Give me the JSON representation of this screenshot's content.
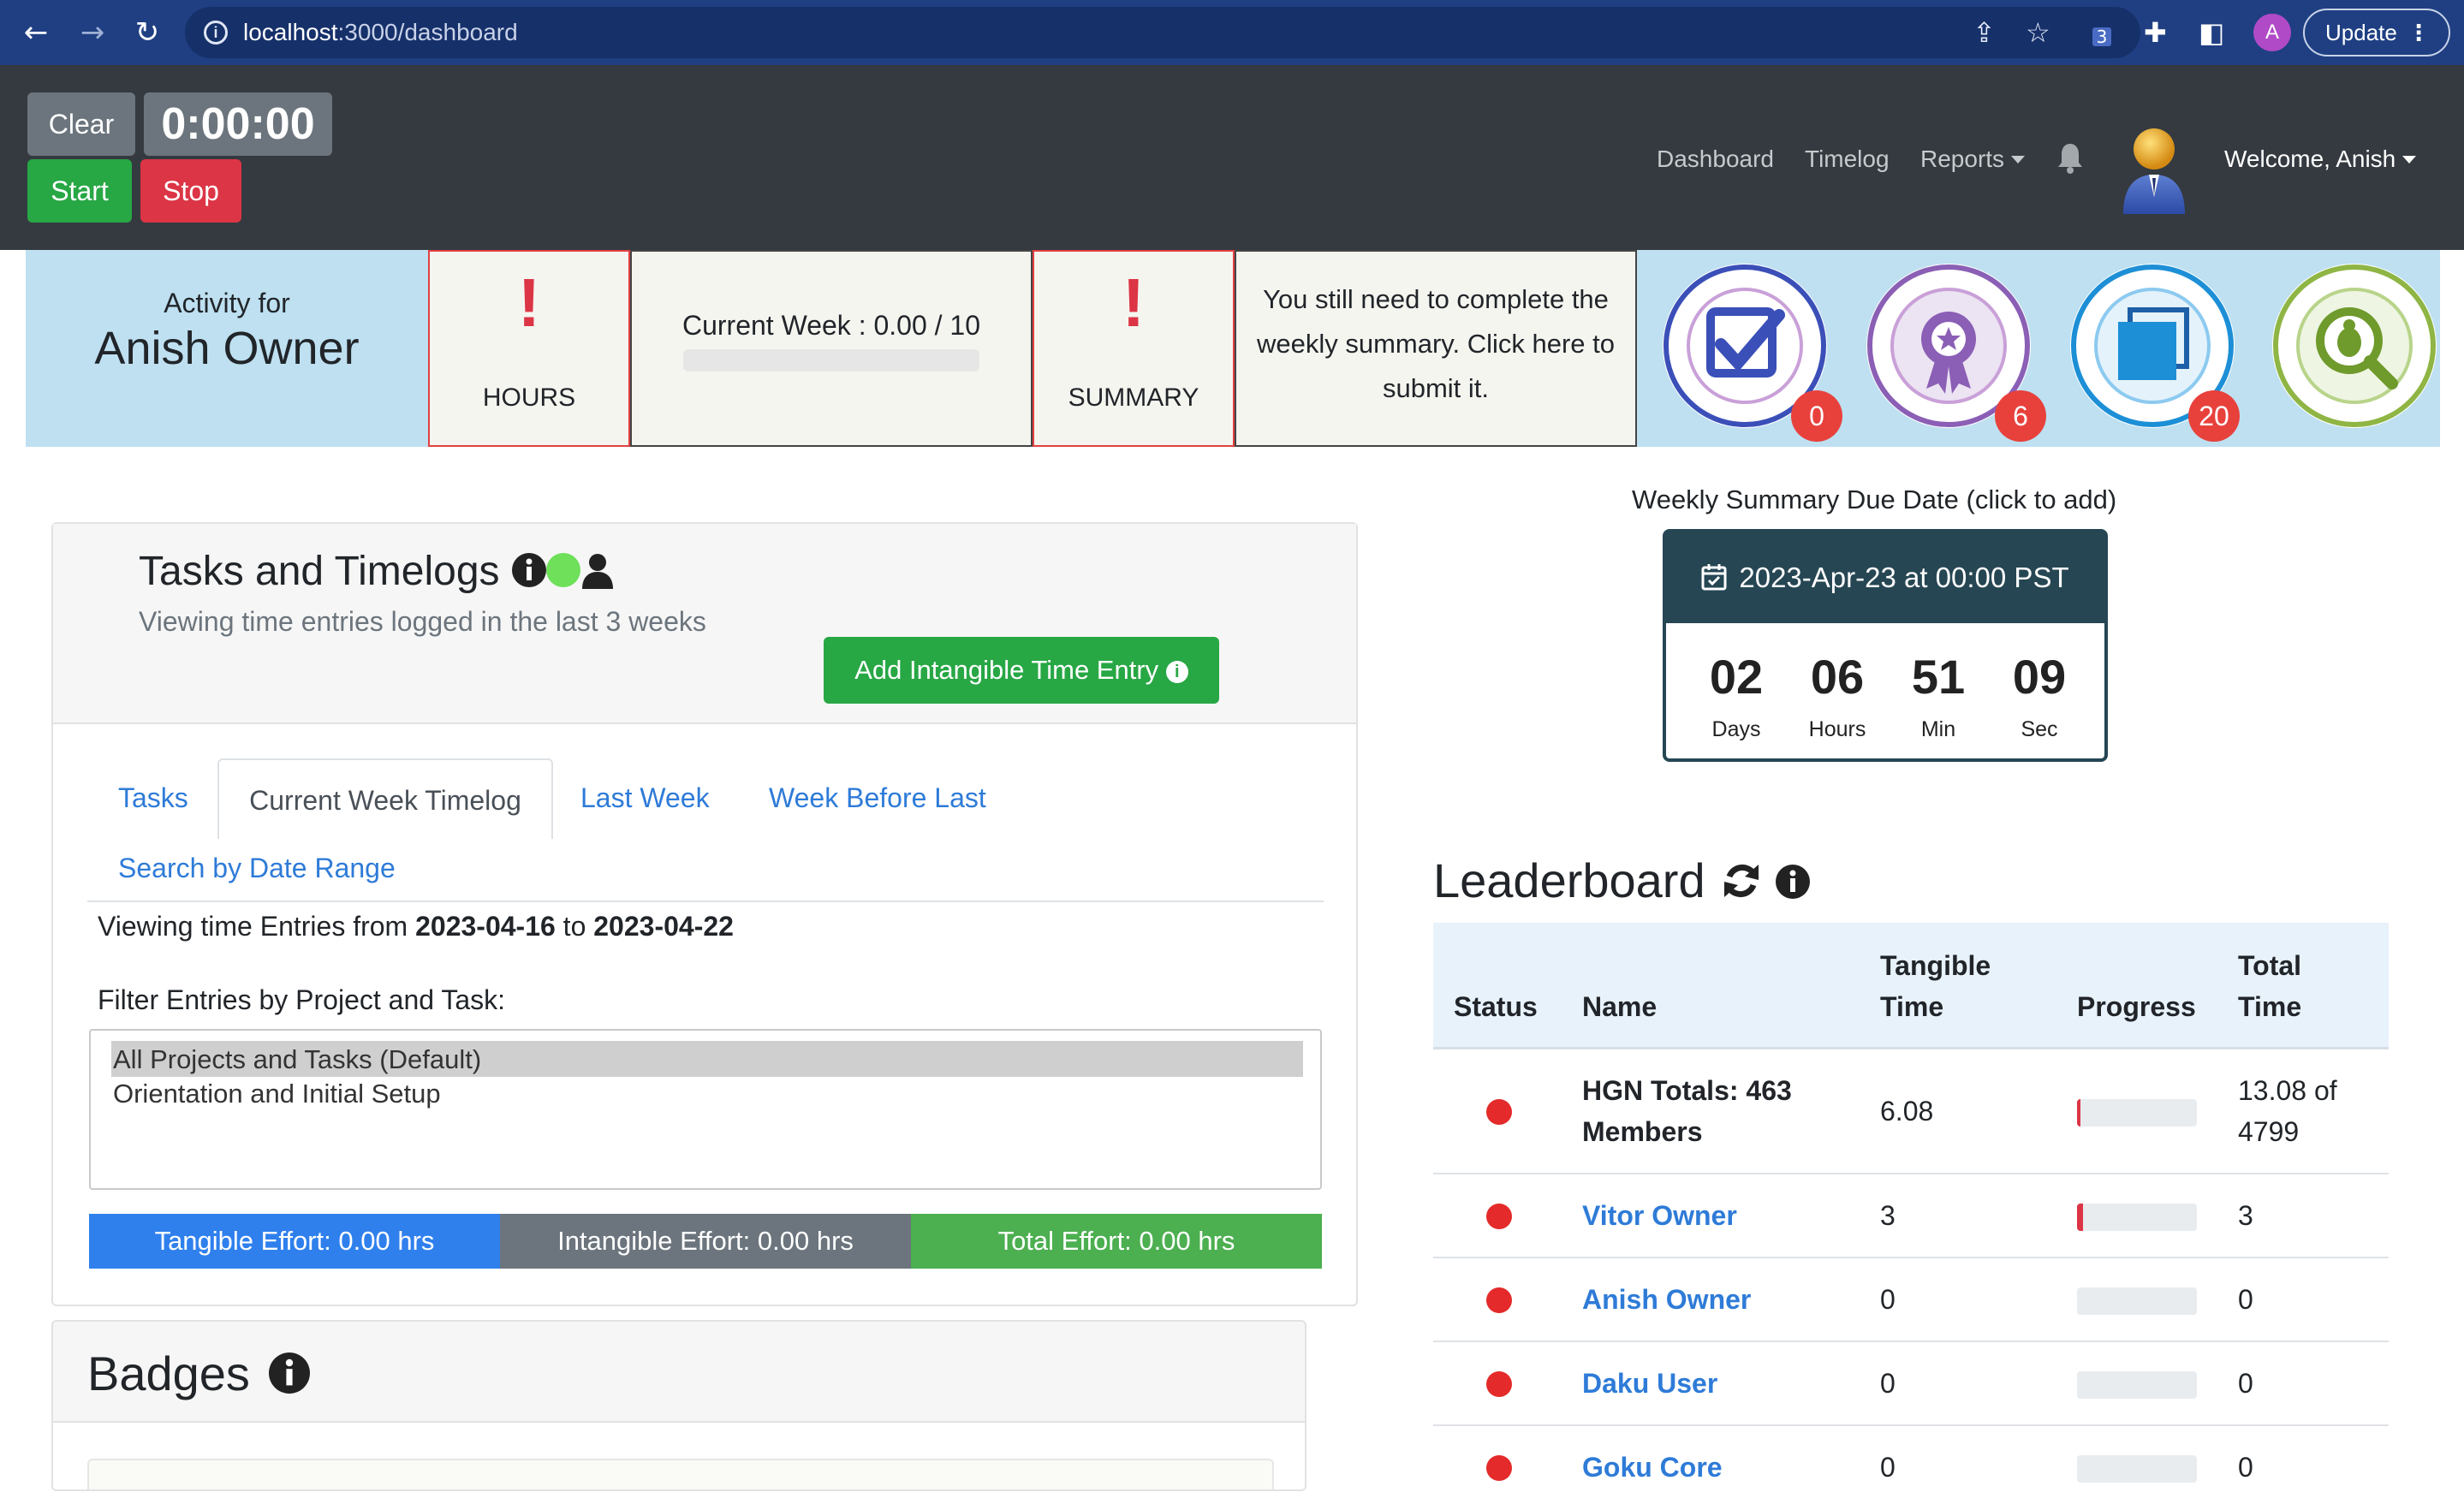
{
  "browser": {
    "url_host": "localhost",
    "url_path": ":3000/dashboard",
    "profile_initial": "A",
    "update_label": "Update",
    "ext_count": "3"
  },
  "timer": {
    "clear_label": "Clear",
    "time": "0:00:00",
    "start_label": "Start",
    "stop_label": "Stop"
  },
  "nav": {
    "dashboard": "Dashboard",
    "timelog": "Timelog",
    "reports": "Reports",
    "welcome": "Welcome, Anish"
  },
  "activity": {
    "line1": "Activity for",
    "name": "Anish Owner",
    "hours_mark": "!",
    "hours_label": "HOURS",
    "current_week": "Current Week : 0.00 / 10",
    "current_week_progress": 0,
    "summary_mark": "!",
    "summary_label": "SUMMARY",
    "summary_text": "You still need to complete the weekly summary. Click here to submit it."
  },
  "badges_strip": [
    {
      "name": "Tasks Why Criteria End State",
      "count": "0",
      "color": "#3b4fb8"
    },
    {
      "name": "Badges Earned",
      "count": "6",
      "color": "#8b5fb5"
    },
    {
      "name": "Blue Square Record",
      "count": "20",
      "color": "#1d8fd6"
    },
    {
      "name": "Report App Bug",
      "count": "",
      "color": "#8fb544"
    }
  ],
  "tasks": {
    "title": "Tasks and Timelogs",
    "subtitle": "Viewing time entries logged in the last 3 weeks",
    "add_button": "Add Intangible Time Entry",
    "tabs": {
      "tasks": "Tasks",
      "current": "Current Week Timelog",
      "last": "Last Week",
      "before_last": "Week Before Last",
      "search": "Search by Date Range"
    },
    "viewing_prefix": "Viewing time Entries from",
    "from_date": "2023-04-16",
    "to_word": "to",
    "to_date": "2023-04-22",
    "filter_label": "Filter Entries by Project and Task:",
    "options": [
      "All Projects and Tasks (Default)",
      "Orientation and Initial Setup"
    ],
    "tangible": "Tangible Effort: 0.00 hrs",
    "intangible": "Intangible Effort: 0.00 hrs",
    "total": "Total Effort: 0.00 hrs"
  },
  "badges_section": {
    "title": "Badges"
  },
  "due": {
    "label": "Weekly Summary Due Date (click to add)",
    "date": "2023-Apr-23 at 00:00 PST",
    "days": "02",
    "days_label": "Days",
    "hours": "06",
    "hours_label": "Hours",
    "min": "51",
    "min_label": "Min",
    "sec": "09",
    "sec_label": "Sec"
  },
  "leaderboard": {
    "title": "Leaderboard",
    "headers": {
      "status": "Status",
      "name": "Name",
      "tangible_1": "Tangible",
      "tangible_2": "Time",
      "progress": "Progress",
      "total_1": "Total",
      "total_2": "Time"
    },
    "rows": [
      {
        "name_1": "HGN Totals: 463",
        "name_2": "Members",
        "tangible": "6.08",
        "progress": 0.03,
        "total_1": "13.08 of",
        "total_2": "4799"
      },
      {
        "name": "Vitor Owner",
        "tangible": "3",
        "progress": 0.05,
        "total": "3"
      },
      {
        "name": "Anish Owner",
        "tangible": "0",
        "progress": 0,
        "total": "0"
      },
      {
        "name": "Daku User",
        "tangible": "0",
        "progress": 0,
        "total": "0"
      },
      {
        "name": "Goku Core",
        "tangible": "0",
        "progress": 0,
        "total": "0"
      }
    ]
  },
  "colors": {
    "navbar": "#343a40",
    "activity_bg": "#bee0f1",
    "success": "#28a745",
    "danger": "#dc3545",
    "link": "#2e7bd8",
    "countdown_head": "#264653"
  }
}
